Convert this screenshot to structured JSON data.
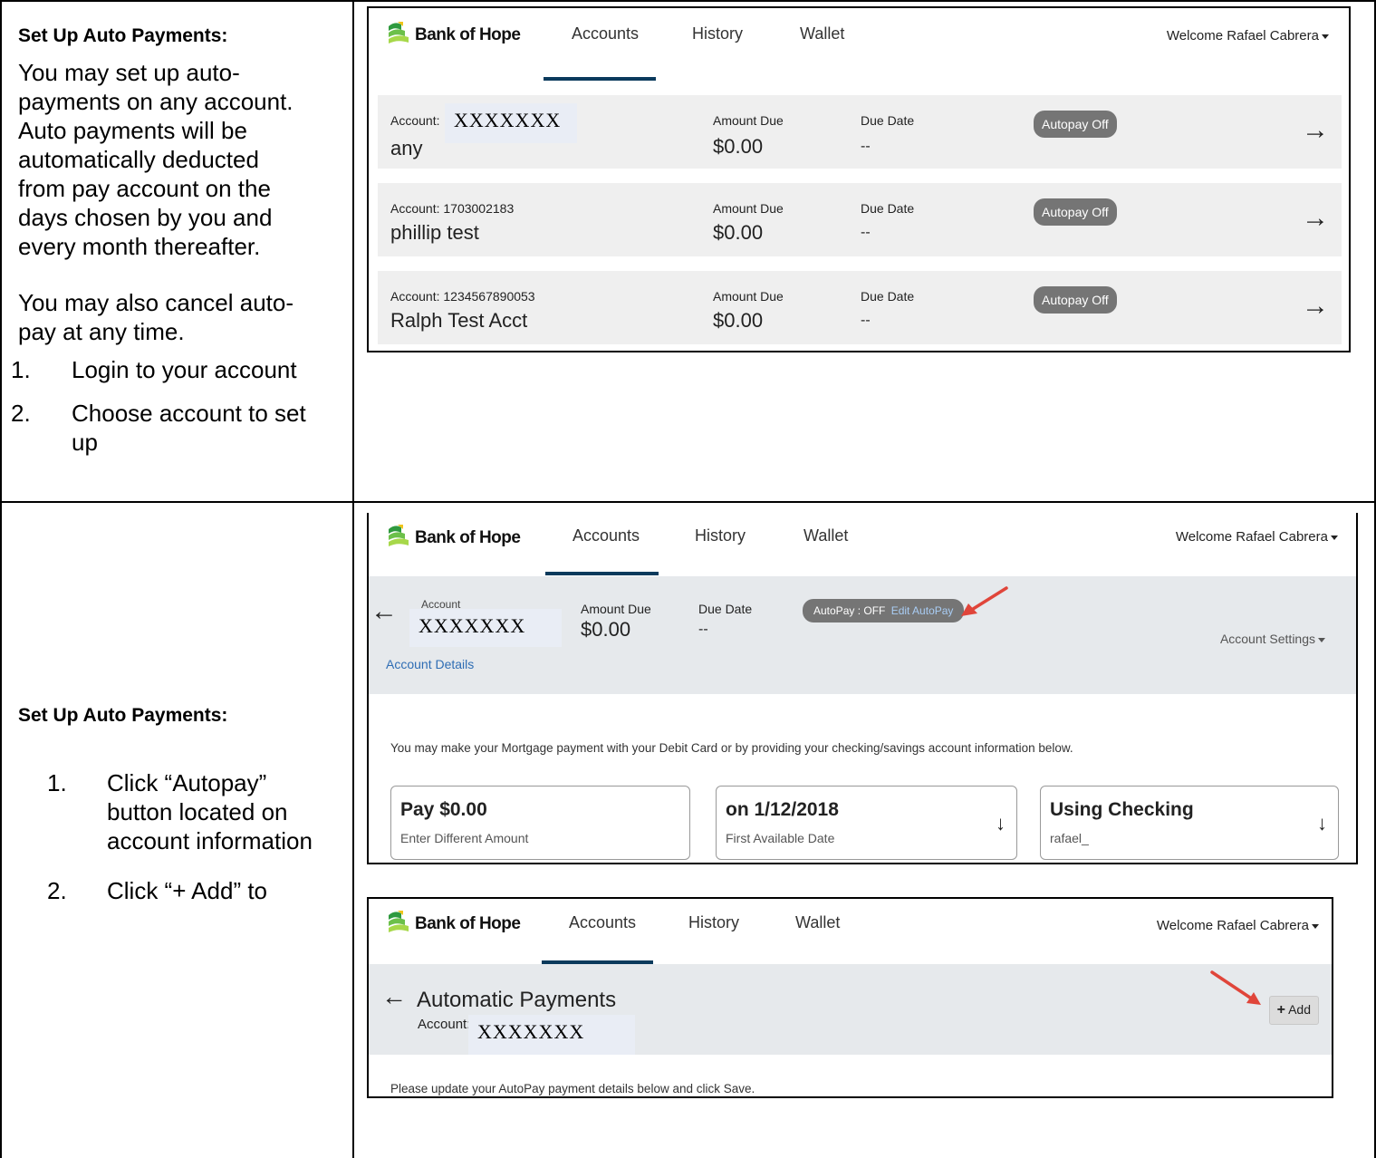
{
  "section1": {
    "heading": "Set Up Auto Payments:",
    "para1_lines": [
      "You may set up auto-",
      "payments on any account.",
      "Auto payments will be",
      "automatically deducted",
      "from pay account on the",
      "days chosen by you and",
      "every month thereafter."
    ],
    "para2_lines": [
      "You may also cancel auto-",
      "pay at any time."
    ],
    "steps": [
      {
        "num": "1.",
        "lines": [
          "Login to your account"
        ]
      },
      {
        "num": "2.",
        "lines": [
          "Choose account to set",
          "up"
        ]
      }
    ]
  },
  "section2": {
    "heading": "Set Up Auto Payments:",
    "steps": [
      {
        "num": "1.",
        "lines": [
          "Click “Autopay”",
          "button located on",
          "account information"
        ]
      },
      {
        "num": "2.",
        "lines": [
          "Click “+ Add” to"
        ]
      }
    ]
  },
  "app": {
    "brand": "Bank of Hope",
    "nav": {
      "accounts": "Accounts",
      "history": "History",
      "wallet": "Wallet"
    },
    "welcome": "Welcome Rafael Cabrera",
    "masked_account": "XXXXXXX"
  },
  "accounts_list": {
    "amount_due_label": "Amount Due",
    "due_date_label": "Due Date",
    "rows": [
      {
        "account_label": "Account:",
        "account_number": "",
        "masked": "XXXXXXX",
        "name": "any",
        "amount_due": "$0.00",
        "due_date": "--",
        "autopay": "Autopay Off"
      },
      {
        "account_label": "Account: 1703002183",
        "account_number": "",
        "masked": "",
        "name": "phillip test",
        "amount_due": "$0.00",
        "due_date": "--",
        "autopay": "Autopay Off"
      },
      {
        "account_label": "Account: 1234567890053",
        "account_number": "",
        "masked": "",
        "name": "Ralph Test Acct",
        "amount_due": "$0.00",
        "due_date": "--",
        "autopay": "Autopay Off"
      }
    ]
  },
  "account_detail": {
    "account_label": "Account",
    "amount_due_label": "Amount Due",
    "amount_due": "$0.00",
    "due_date_label": "Due Date",
    "due_date": "--",
    "autopay_status": "AutoPay : OFF",
    "edit_autopay": "Edit AutoPay",
    "account_details_link": "Account Details",
    "account_settings": "Account Settings",
    "instruction": "You may make your Mortgage payment with your Debit Card or by providing your checking/savings account information below.",
    "boxes": [
      {
        "title": "Pay $0.00",
        "sub": "Enter Different Amount"
      },
      {
        "title": "on 1/12/2018",
        "sub": "First Available Date"
      },
      {
        "title": "Using Checking",
        "sub": "rafael_"
      }
    ]
  },
  "automatic_payments": {
    "title": "Automatic Payments",
    "account_label": "Account:",
    "add_label": "Add",
    "instruction": "Please update your AutoPay payment details below and click Save."
  },
  "icons": {
    "back": "back-arrow-icon",
    "forward": "forward-arrow-icon",
    "down": "down-arrow-icon",
    "plus": "plus-icon",
    "caret": "caret-down-icon",
    "annotation": "red-annotation-arrow"
  },
  "colors": {
    "nav_underline": "#0a3a5c",
    "pill": "#757575",
    "band": "#e6e9ec",
    "link": "#2e6db4",
    "annotation": "#e0453a"
  }
}
